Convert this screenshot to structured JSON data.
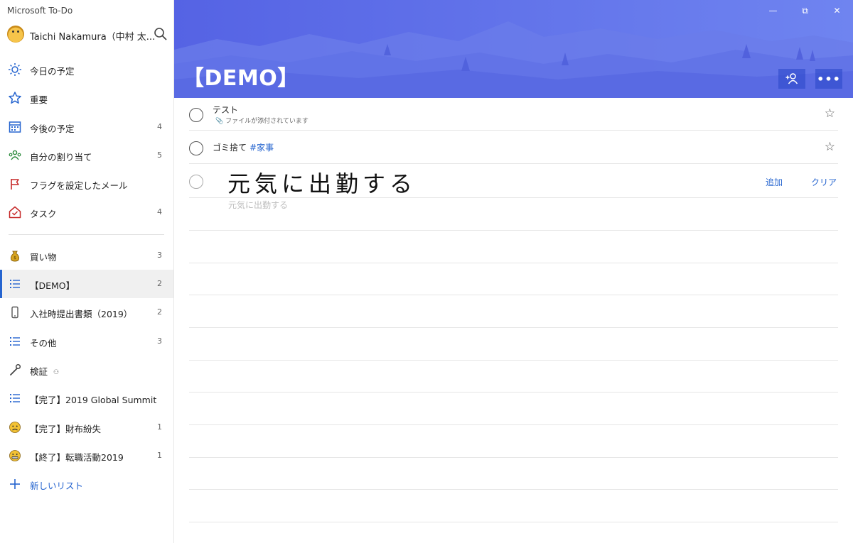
{
  "window": {
    "title": "Microsoft To-Do"
  },
  "user": {
    "name": "Taichi Nakamura（中村 太..."
  },
  "nav": {
    "smart_lists": [
      {
        "label": "今日の予定",
        "icon": "sun-icon",
        "count": ""
      },
      {
        "label": "重要",
        "icon": "star-icon",
        "count": ""
      },
      {
        "label": "今後の予定",
        "icon": "calendar-icon",
        "count": "4"
      },
      {
        "label": "自分の割り当て",
        "icon": "people-icon",
        "count": "5"
      },
      {
        "label": "フラグを設定したメール",
        "icon": "flag-icon",
        "count": ""
      },
      {
        "label": "タスク",
        "icon": "home-icon",
        "count": "4"
      }
    ],
    "lists": [
      {
        "label": "買い物",
        "icon": "money-bag-icon",
        "count": "3"
      },
      {
        "label": "【DEMO】",
        "icon": "list-icon",
        "count": "2",
        "active": true
      },
      {
        "label": "入社時提出書類（2019）",
        "icon": "phone-icon",
        "count": "2"
      },
      {
        "label": "その他",
        "icon": "list-icon",
        "count": "3"
      },
      {
        "label": "検証",
        "icon": "wrench-icon",
        "count": ""
      },
      {
        "label": "【完了】2019 Global Summit",
        "icon": "list-icon",
        "count": ""
      },
      {
        "label": "【完了】財布紛失",
        "icon": "sad-face-icon",
        "count": "1"
      },
      {
        "label": "【終了】転職活動2019",
        "icon": "grimace-face-icon",
        "count": "1"
      }
    ],
    "new_list": "新しいリスト"
  },
  "header": {
    "title": "【DEMO】"
  },
  "tasks": [
    {
      "title": "テスト",
      "subtitle": "ファイルが添付されています",
      "tag": ""
    },
    {
      "title": "ゴミ捨て",
      "subtitle": "",
      "tag": "#家事"
    }
  ],
  "add_task": {
    "handwriting": "元気に出勤する",
    "recognized": "元気に出勤する",
    "add_label": "追加",
    "clear_label": "クリア"
  },
  "colors": {
    "accent": "#2564cf",
    "banner": "#6577ea"
  }
}
